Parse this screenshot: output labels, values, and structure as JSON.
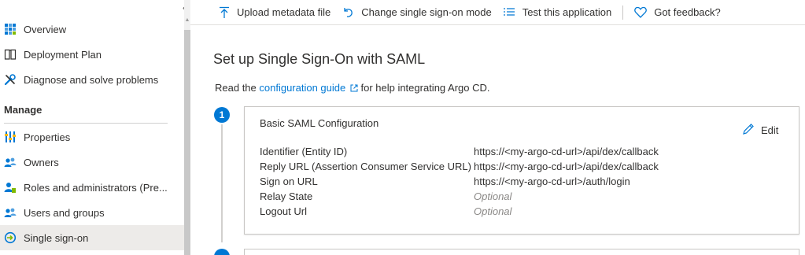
{
  "sidebar": {
    "collapse_glyph": "«",
    "items_top": [
      {
        "label": "Overview",
        "icon": "overview-grid-icon"
      },
      {
        "label": "Deployment Plan",
        "icon": "book-icon"
      },
      {
        "label": "Diagnose and solve problems",
        "icon": "wrench-icon"
      }
    ],
    "section_label": "Manage",
    "items_manage": [
      {
        "label": "Properties",
        "icon": "properties-icon"
      },
      {
        "label": "Owners",
        "icon": "users-icon"
      },
      {
        "label": "Roles and administrators (Pre...",
        "icon": "user-role-icon"
      },
      {
        "label": "Users and groups",
        "icon": "users-icon"
      },
      {
        "label": "Single sign-on",
        "icon": "sso-icon"
      }
    ]
  },
  "toolbar": {
    "upload": "Upload metadata file",
    "change_mode": "Change single sign-on mode",
    "test": "Test this application",
    "feedback": "Got feedback?"
  },
  "main": {
    "title": "Set up Single Sign-On with SAML",
    "intro_prefix": "Read the ",
    "intro_link": "configuration guide",
    "intro_suffix": " for help integrating Argo CD."
  },
  "step1": {
    "number": "1",
    "card_title": "Basic SAML Configuration",
    "edit_label": "Edit",
    "rows": [
      {
        "key": "Identifier (Entity ID)",
        "value": "https://<my-argo-cd-url>/api/dex/callback",
        "optional": false
      },
      {
        "key": "Reply URL (Assertion Consumer Service URL)",
        "value": "https://<my-argo-cd-url>/api/dex/callback",
        "optional": false
      },
      {
        "key": "Sign on URL",
        "value": "https://<my-argo-cd-url>/auth/login",
        "optional": false
      },
      {
        "key": "Relay State",
        "value": "Optional",
        "optional": true
      },
      {
        "key": "Logout Url",
        "value": "Optional",
        "optional": true
      }
    ]
  },
  "colors": {
    "accent": "#0078d4",
    "active_bg": "#edebe9",
    "text": "#323130",
    "muted": "#8a8886"
  }
}
